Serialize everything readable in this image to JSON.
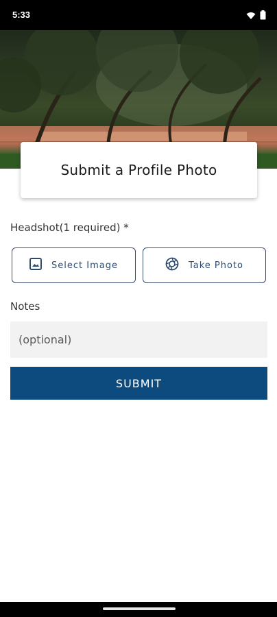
{
  "status_bar": {
    "time": "5:33",
    "icons": [
      "wifi-icon",
      "battery-icon"
    ]
  },
  "page": {
    "title": "Submit a Profile Photo"
  },
  "headshot": {
    "label": "Headshot(1 required) *",
    "select_image_label": "Select Image",
    "take_photo_label": "Take Photo"
  },
  "notes": {
    "label": "Notes",
    "placeholder": "(optional)",
    "value": ""
  },
  "submit_label": "SUBMIT",
  "colors": {
    "accent": "#0d4a7e",
    "outline": "#34496b"
  }
}
